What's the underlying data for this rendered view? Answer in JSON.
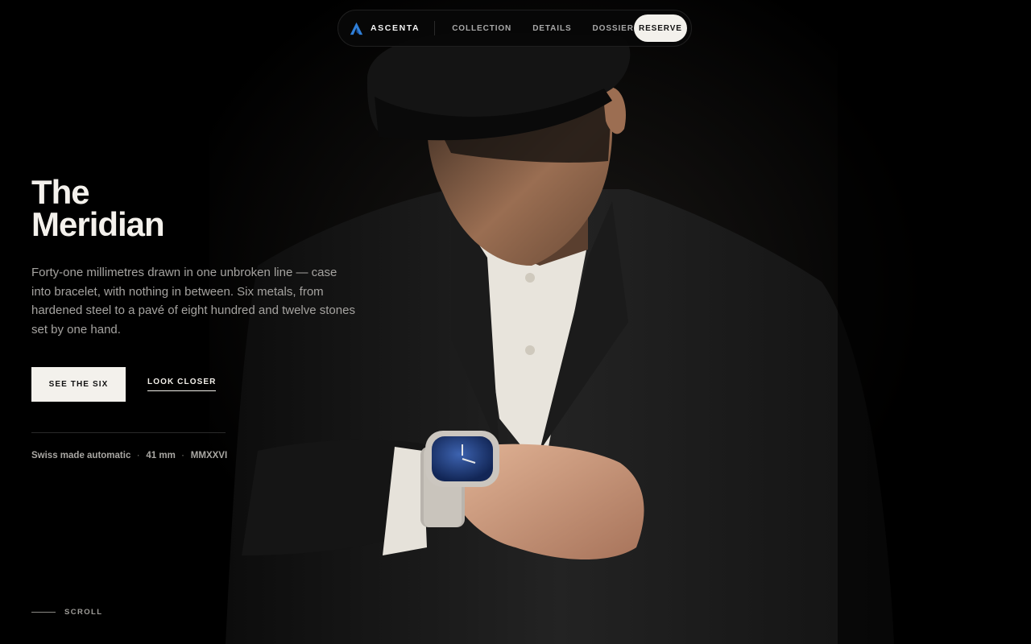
{
  "nav": {
    "brand_name": "ASCENTA",
    "brand_icon": "a-monogram-logo-icon",
    "links": [
      "COLLECTION",
      "DETAILS",
      "DOSSIER"
    ],
    "reserve_label": "RESERVE"
  },
  "hero": {
    "title_line1": "The",
    "title_line2": "Meridian",
    "lede": "Forty-one millimetres drawn in one unbroken line — case into bracelet, with nothing in between. Six metals, from hardened steel to a pavé of eight hundred and twelve stones set by one hand.",
    "cta_primary": "SEE THE SIX",
    "cta_secondary": "LOOK CLOSER",
    "specs": [
      "Swiss made automatic",
      "41 mm",
      "MMXXVI"
    ],
    "spec_separator": "·",
    "scroll_label": "SCROLL"
  },
  "colors": {
    "background": "#000000",
    "text": "#f2efe9",
    "muted": "#a5a3a0",
    "button_bg": "#f3f1ec",
    "logo_blue": "#2f7fd8",
    "dial_blue": "#1c3a78"
  }
}
